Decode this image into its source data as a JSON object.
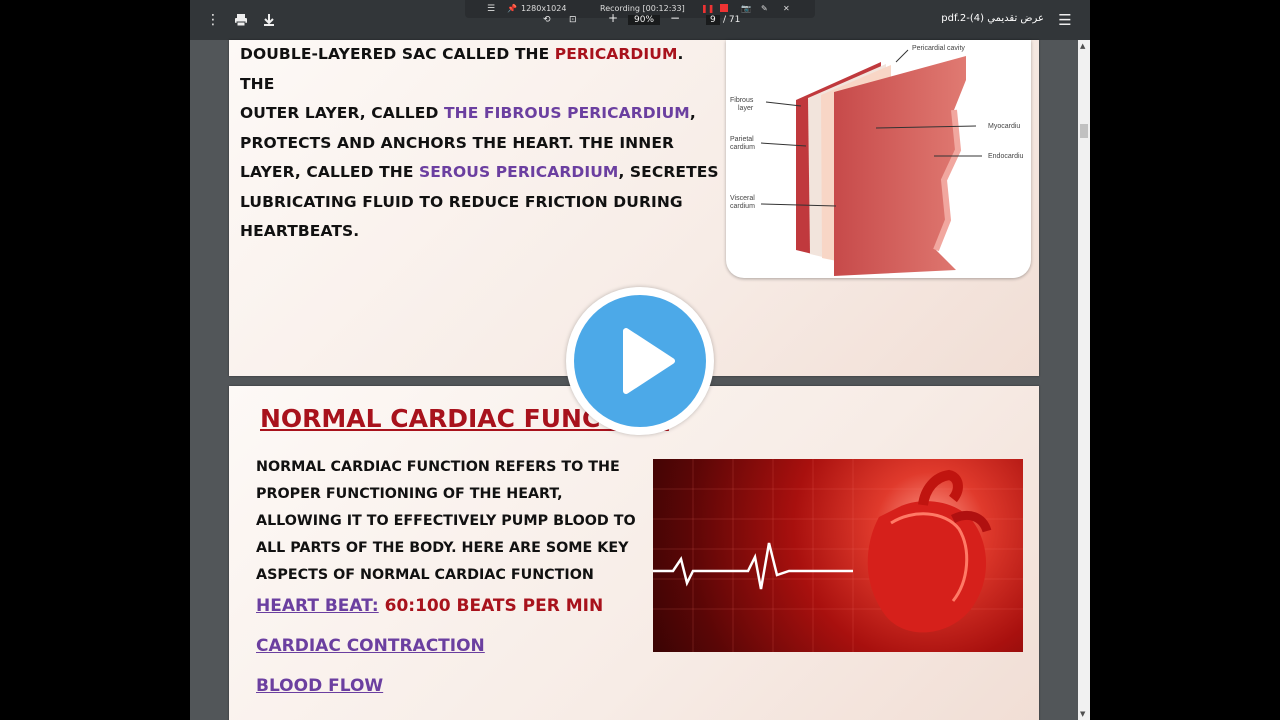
{
  "toolbar": {
    "title": "عرض تقديمي (4)-pdf.2",
    "zoom": "90%",
    "page_current": "9",
    "page_total": "/ 71",
    "zoom_in": "+",
    "zoom_out": "−",
    "menu_icon": "hamburger-icon",
    "more_icon": "kebab-icon",
    "print_icon": "print-icon",
    "download_icon": "download-icon",
    "rotate_icon": "rotate-icon",
    "fit_icon": "fit-page-icon"
  },
  "recorder": {
    "resolution": "1280x1024",
    "status": "Recording [00:12:33]"
  },
  "page1": {
    "line1_a": "DOUBLE-LAYERED SAC CALLED THE ",
    "line1_b": "PERICARDIUM",
    "line1_c": ". THE",
    "line2_a": "OUTER LAYER, CALLED ",
    "line2_b": "THE FIBROUS PERICARDIUM",
    "line2_c": ",",
    "line3": "PROTECTS AND ANCHORS THE HEART. THE INNER",
    "line4_a": "LAYER, CALLED THE ",
    "line4_b": "SEROUS PERICARDIUM",
    "line4_c": ", SECRETES",
    "line5": "LUBRICATING FLUID TO REDUCE FRICTION DURING",
    "line6": "HEARTBEATS.",
    "diagram": {
      "pericardial_cavity": "Pericardial cavity",
      "fibrous_layer_1": "Fibrous",
      "fibrous_layer_2": "layer",
      "parietal_1": "Parietal",
      "parietal_2": "cardium",
      "visceral_1": "Visceral",
      "visceral_2": "cardium",
      "myocardium": "Myocardiu",
      "endocardium": "Endocardiu"
    }
  },
  "page2": {
    "heading": "NORMAL CARDIAC FUNCTION",
    "para_1": "NORMAL CARDIAC FUNCTION REFERS TO THE",
    "para_2": "PROPER FUNCTIONING OF THE HEART,",
    "para_3": "ALLOWING IT TO EFFECTIVELY PUMP BLOOD TO",
    "para_4": "ALL PARTS OF THE BODY. HERE ARE SOME KEY",
    "para_5": "ASPECTS OF NORMAL CARDIAC FUNCTION",
    "heart_beat_label": "HEART BEAT:",
    "heart_beat_value": " 60:100 BEATS PER MIN",
    "cardiac_contraction": "CARDIAC CONTRACTION",
    "blood_flow": "BLOOD FLOW"
  },
  "overlay": {
    "play_icon": "play-icon"
  }
}
